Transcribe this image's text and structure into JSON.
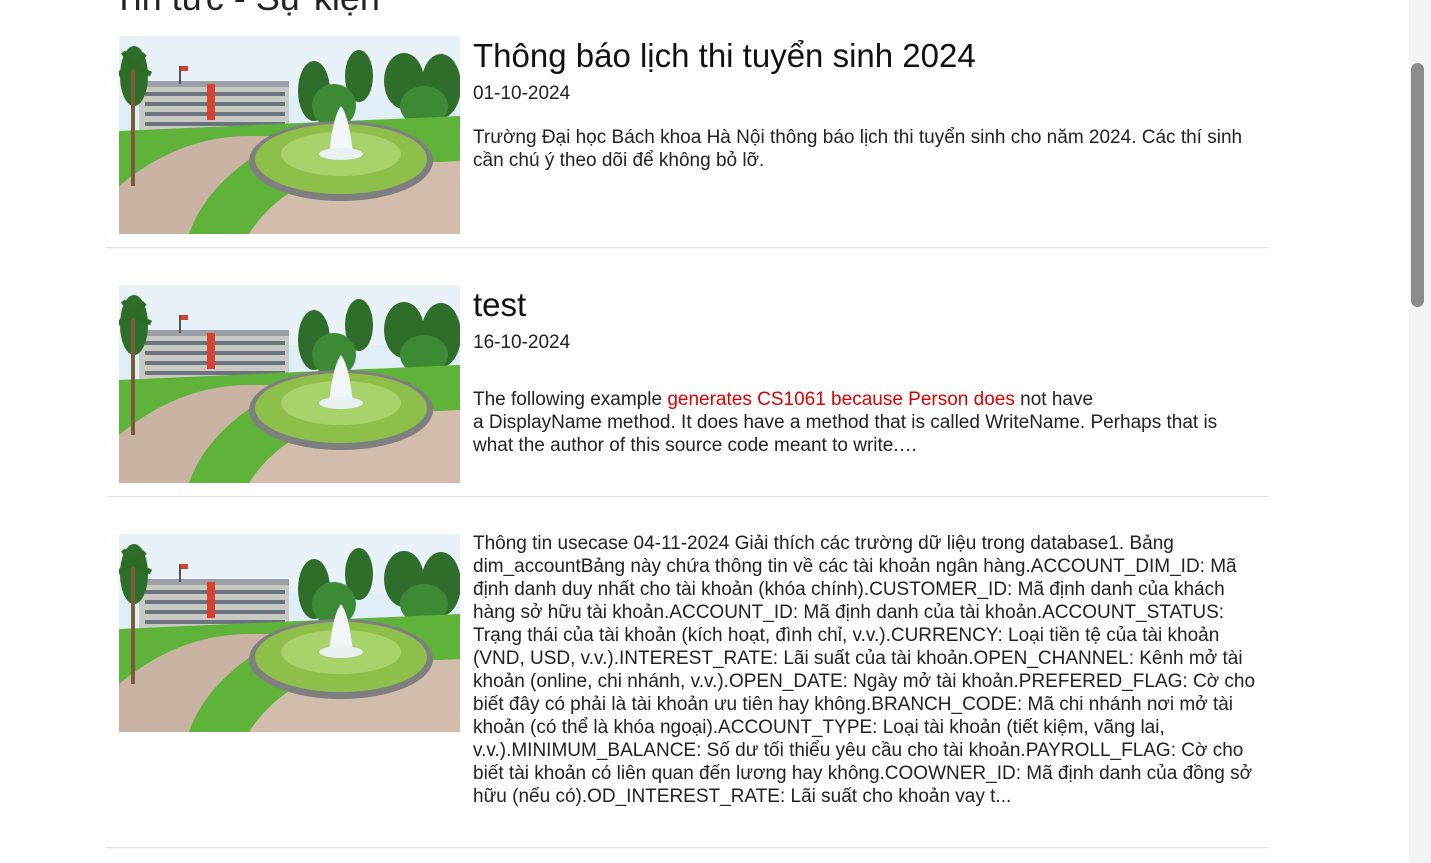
{
  "section_title": "Tin tức - Sự kiện",
  "news": [
    {
      "title": "Thông báo lịch thi tuyển sinh 2024",
      "date": "01-10-2024",
      "summary": "Trường Đại học Bách khoa Hà Nội thông báo lịch thi tuyển sinh cho năm 2024. Các thí sinh cần chú ý theo dõi để không bỏ lỡ."
    },
    {
      "title": "test",
      "date": "16-10-2024",
      "summary_parts": {
        "p1": "The following example ",
        "p2_red": "generates CS1061 because Person does",
        "p3": " not have",
        "p4": "a DisplayName method. It does have a method that is called WriteName. Perhaps that is what the author of this source code meant to write.…"
      }
    },
    {
      "title": "",
      "date": "",
      "summary": "Thông tin usecase 04-11-2024  Giải thích các trường dữ liệu trong database1. Bảng dim_accountBảng này chứa thông tin về các tài khoản ngân hàng.ACCOUNT_DIM_ID: Mã định danh duy nhất cho tài khoản (khóa chính).CUSTOMER_ID: Mã định danh của khách hàng sở hữu tài khoản.ACCOUNT_ID: Mã định danh của tài khoản.ACCOUNT_STATUS: Trạng thái của tài khoản (kích hoạt, đình chỉ, v.v.).CURRENCY: Loại tiền tệ của tài khoản (VND, USD, v.v.).INTEREST_RATE: Lãi suất của tài khoản.OPEN_CHANNEL: Kênh mở tài khoản (online, chi nhánh, v.v.).OPEN_DATE: Ngày mở tài khoản.PREFERED_FLAG: Cờ cho biết đây có phải là tài khoản ưu tiên hay không.BRANCH_CODE: Mã chi nhánh nơi mở tài khoản (có thể là khóa ngoại).ACCOUNT_TYPE: Loại tài khoản (tiết kiệm, vãng lai, v.v.).MINIMUM_BALANCE: Số dư tối thiểu yêu cầu cho tài khoản.PAYROLL_FLAG: Cờ cho biết tài khoản có liên quan đến lương hay không.COOWNER_ID: Mã định danh của đồng sở hữu (nếu có).OD_INTEREST_RATE: Lãi suất cho khoản vay t..."
    }
  ],
  "colors": {
    "highlight": "#e00000",
    "divider": "#e3e3e3",
    "scrollbar_thumb": "#8c8c8c"
  }
}
